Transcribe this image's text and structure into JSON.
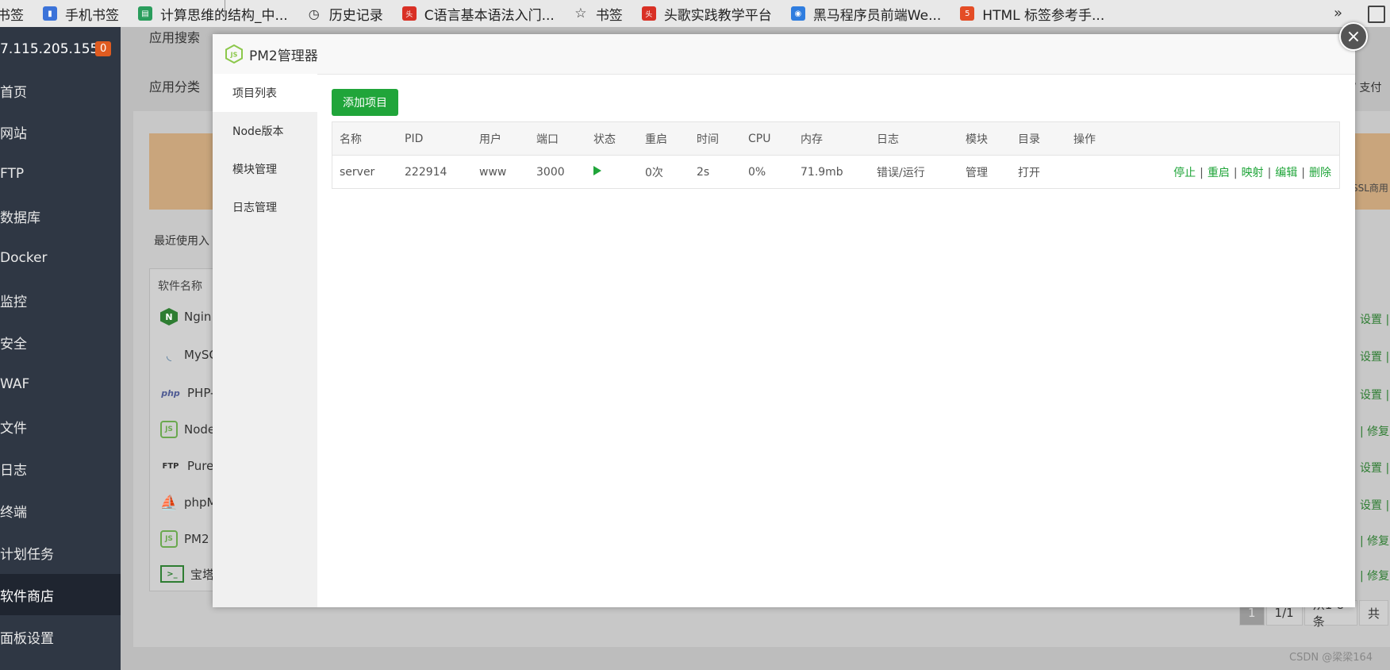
{
  "bookmarks": [
    {
      "label": "书签",
      "icon": "bookmark-icon",
      "color": ""
    },
    {
      "label": "手机书签",
      "icon": "phone-bookmark-icon",
      "color": "#3b73d9"
    },
    {
      "label": "计算思维的结构_中...",
      "icon": "book-icon",
      "color": "#2a9d5c"
    },
    {
      "label": "历史记录",
      "icon": "clock-icon",
      "color": ""
    },
    {
      "label": "C语言基本语法入门...",
      "icon": "toutiao-icon",
      "color": "#d93025"
    },
    {
      "label": "书签",
      "icon": "star-icon",
      "color": ""
    },
    {
      "label": "头歌实践教学平台",
      "icon": "toutiao-icon",
      "color": "#d93025"
    },
    {
      "label": "黑马程序员前端We...",
      "icon": "robot-icon",
      "color": "#2f7ddf"
    },
    {
      "label": "HTML 标签参考手...",
      "icon": "html5-icon",
      "color": "#e44d26"
    }
  ],
  "bookmarks_more": "»",
  "sidebar": {
    "ip": "7.115.205.155",
    "badge": "0",
    "items": [
      "首页",
      "网站",
      "FTP",
      "数据库",
      "Docker",
      "监控",
      "安全",
      "WAF",
      "文件",
      "日志",
      "终端",
      "计划任务",
      "软件商店",
      "面板设置"
    ],
    "active_index": 12
  },
  "background": {
    "app_search_label": "应用搜索",
    "app_category_label": "应用分类",
    "recent_label": "最近使用入",
    "right_top_text": ": / 支付",
    "ssl_text": "SSL商用",
    "soft_header": "软件名称",
    "soft_rows": [
      {
        "name": "Ngin",
        "icon": "nginx-icon"
      },
      {
        "name": "MySC",
        "icon": "mysql-icon"
      },
      {
        "name": "PHP-",
        "icon": "php-icon"
      },
      {
        "name": "Node",
        "icon": "nodejs-icon"
      },
      {
        "name": "Pure-",
        "icon": "ftp-icon"
      },
      {
        "name": "phpM",
        "icon": "phpmyadmin-icon"
      },
      {
        "name": "PM2",
        "icon": "nodejs-icon"
      },
      {
        "name": "宝塔S",
        "icon": "terminal-icon"
      }
    ],
    "right_links": [
      "设置 |",
      "设置 |",
      "设置 |",
      "| 修复",
      "设置 |",
      "设置 |",
      "| 修复",
      "| 修复"
    ],
    "pager": [
      "1",
      "1/1",
      "从1-8条",
      "共"
    ],
    "watermark": "CSDN @梁梁164"
  },
  "modal": {
    "title": "PM2管理器",
    "tabs": [
      "项目列表",
      "Node版本",
      "模块管理",
      "日志管理"
    ],
    "active_tab": 0,
    "add_button": "添加项目",
    "columns": [
      "名称",
      "PID",
      "用户",
      "端口",
      "状态",
      "重启",
      "时间",
      "CPU",
      "内存",
      "日志",
      "模块",
      "目录",
      "操作"
    ],
    "rows": [
      {
        "name": "server",
        "pid": "222914",
        "user": "www",
        "port": "3000",
        "status": "running",
        "restarts": "0次",
        "time": "2s",
        "cpu": "0%",
        "memory": "71.9mb",
        "log": "错误/运行",
        "module": "管理",
        "dir": "打开",
        "ops": [
          "停止",
          "重启",
          "映射",
          "编辑",
          "删除"
        ]
      }
    ]
  },
  "colors": {
    "accent": "#20a53a",
    "sidebar": "#2f3744",
    "badge": "#e05b20"
  }
}
